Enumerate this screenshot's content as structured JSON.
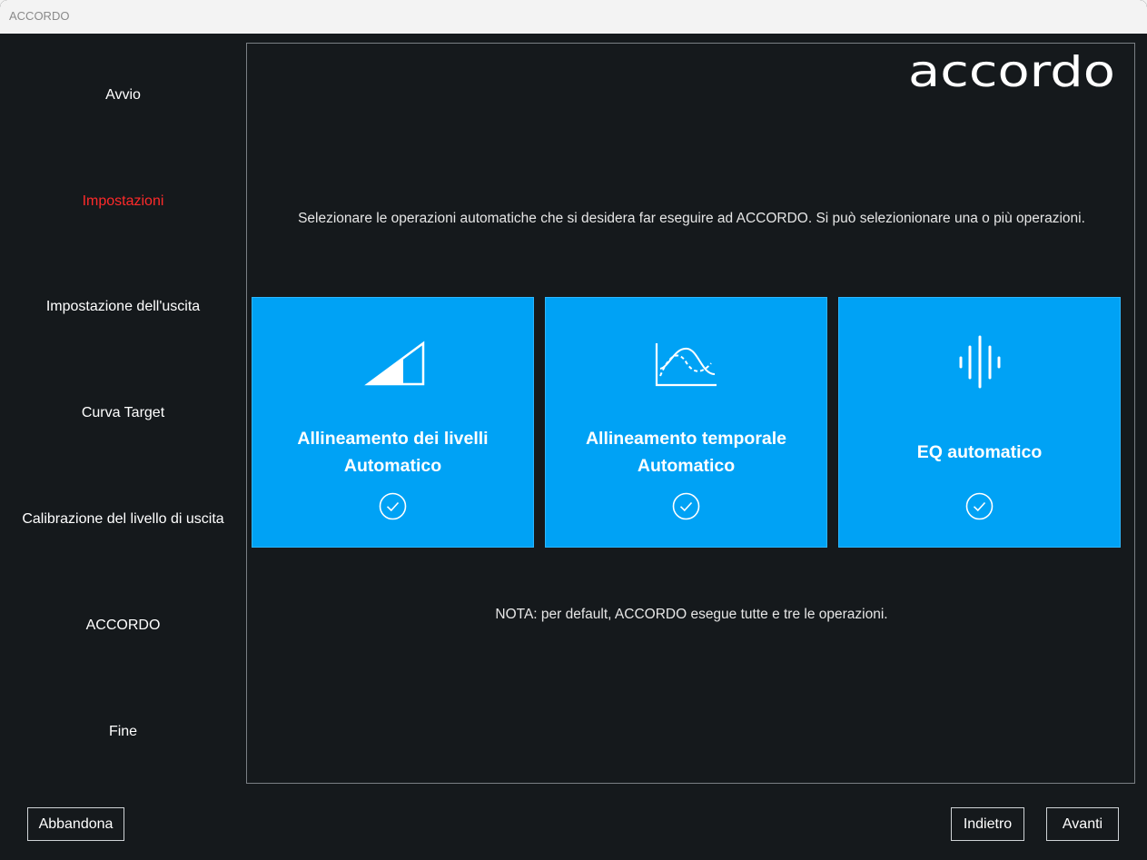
{
  "window": {
    "title": "ACCORDO"
  },
  "sidebar": {
    "steps": [
      {
        "label": "Avvio"
      },
      {
        "label": "Impostazioni",
        "active": true
      },
      {
        "label": "Impostazione dell'uscita"
      },
      {
        "label": "Curva Target"
      },
      {
        "label": "Calibrazione del livello di uscita"
      },
      {
        "label": "ACCORDO"
      },
      {
        "label": "Fine"
      }
    ]
  },
  "main": {
    "logo_text": "accordo",
    "instructions": "Selezionare le operazioni automatiche che si desidera far eseguire ad ACCORDO. Si può selezionionare una o più operazioni.",
    "cards": [
      {
        "title_line1": "Allineamento dei livelli",
        "title_line2": "Automatico",
        "icon": "level-ramp-icon",
        "checked": true
      },
      {
        "title_line1": "Allineamento temporale",
        "title_line2": "Automatico",
        "icon": "time-wave-icon",
        "checked": true
      },
      {
        "title_line1": "EQ automatico",
        "title_line2": "",
        "icon": "audio-bars-icon",
        "checked": true
      }
    ],
    "note": "NOTA: per default, ACCORDO esegue tutte e tre le operazioni."
  },
  "footer": {
    "abandon_label": "Abbandona",
    "back_label": "Indietro",
    "next_label": "Avanti"
  },
  "colors": {
    "background": "#15191c",
    "accent": "#00a2f5",
    "active_step": "#ff2a2a"
  }
}
